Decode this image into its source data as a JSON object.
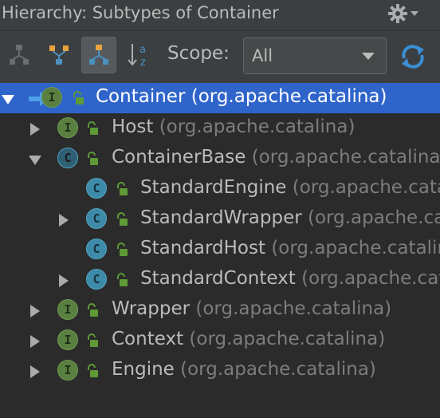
{
  "window": {
    "title": "Hierarchy: Subtypes of Container"
  },
  "toolbar": {
    "buttons": [
      {
        "name": "supertypes-hierarchy",
        "icon": "supertypes-icon",
        "active": false
      },
      {
        "name": "subtypes-hierarchy",
        "icon": "subtypes-icon",
        "active": false
      },
      {
        "name": "class-hierarchy",
        "icon": "class-hierarchy-icon",
        "active": true
      },
      {
        "name": "sort-alphabetically",
        "icon": "sort-alpha-icon",
        "active": false
      }
    ],
    "scope_label": "Scope:",
    "scope_value": "All",
    "refresh_icon": "refresh-icon"
  },
  "colors": {
    "interface": "#598040",
    "class": "#3d8ba9",
    "selection": "#2f65ca",
    "lock": "#5e9a36"
  },
  "tree": {
    "rows": [
      {
        "name": "Container",
        "package": "(org.apache.catalina)",
        "kind": "interface",
        "expand": "down",
        "selected": true
      },
      {
        "name": "Host",
        "package": "(org.apache.catalina)",
        "kind": "interface",
        "expand": "right",
        "selected": false
      },
      {
        "name": "ContainerBase",
        "package": "(org.apache.catalina.core)",
        "kind": "abstract-class",
        "expand": "down",
        "selected": false
      },
      {
        "name": "StandardEngine",
        "package": "(org.apache.catalina.core)",
        "kind": "class",
        "expand": "none",
        "selected": false
      },
      {
        "name": "StandardWrapper",
        "package": "(org.apache.catalina.core)",
        "kind": "class",
        "expand": "right",
        "selected": false
      },
      {
        "name": "StandardHost",
        "package": "(org.apache.catalina.core)",
        "kind": "class",
        "expand": "none",
        "selected": false
      },
      {
        "name": "StandardContext",
        "package": "(org.apache.catalina.core)",
        "kind": "class",
        "expand": "right",
        "selected": false
      },
      {
        "name": "Wrapper",
        "package": "(org.apache.catalina)",
        "kind": "interface",
        "expand": "right",
        "selected": false
      },
      {
        "name": "Context",
        "package": "(org.apache.catalina)",
        "kind": "interface",
        "expand": "right",
        "selected": false
      },
      {
        "name": "Engine",
        "package": "(org.apache.catalina)",
        "kind": "interface",
        "expand": "right",
        "selected": false
      }
    ],
    "badge_letters": {
      "interface": "I",
      "class": "C"
    }
  }
}
